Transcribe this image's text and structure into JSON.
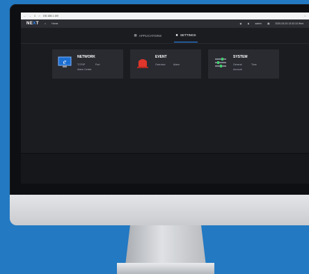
{
  "browser": {
    "back_icon": "arrow-left-icon",
    "forward_icon": "arrow-right-icon",
    "reload_icon": "reload-icon",
    "url": "192.168.1.100"
  },
  "header": {
    "logo_main": "NE",
    "logo_x": "X",
    "logo_end": "T",
    "home_label": "Home",
    "user": "admin",
    "datetime": "2020-03-03 13:32:10 Wed"
  },
  "tabs": [
    {
      "label": "APPLICATIONS",
      "icon": "grid-icon",
      "active": false
    },
    {
      "label": "SETTINGS",
      "icon": "gear-icon",
      "active": true
    }
  ],
  "cards": {
    "network": {
      "title": "NETWORK",
      "links": [
        "TCP/IP",
        "Port",
        "Alarm Center"
      ],
      "icon": "monitor-icon"
    },
    "event": {
      "title": "EVENT",
      "links": [
        "Overview",
        "Alarm"
      ],
      "icon": "siren-icon"
    },
    "system": {
      "title": "SYSTEM",
      "links": [
        "General",
        "Time",
        "Account"
      ],
      "icon": "sliders-icon"
    }
  },
  "colors": {
    "accent": "#2a8cff",
    "background": "#2379c2",
    "screen": "#1b1c20"
  }
}
